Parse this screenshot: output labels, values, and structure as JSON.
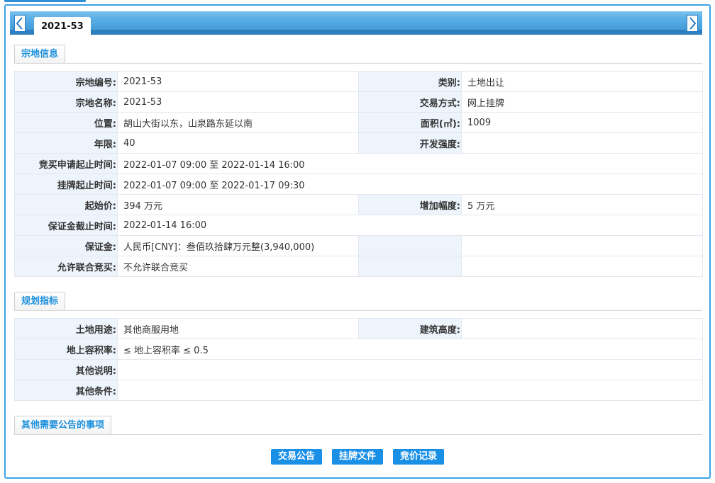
{
  "tab": {
    "label": "2021-53"
  },
  "sections": {
    "basic": "宗地信息",
    "planning": "规划指标",
    "other": "其他需要公告的事项"
  },
  "basic_rows": [
    {
      "k1": "宗地编号:",
      "v1": "2021-53",
      "k2": "类别:",
      "v2": "土地出让"
    },
    {
      "k1": "宗地名称:",
      "v1": "2021-53",
      "k2": "交易方式:",
      "v2": "网上挂牌"
    },
    {
      "k1": "位置:",
      "v1": "胡山大街以东，山泉路东延以南",
      "k2": "面积(㎡):",
      "v2": "1009"
    },
    {
      "k1": "年限:",
      "v1": "40",
      "k2": "开发强度:",
      "v2": ""
    },
    {
      "k1": "竞买申请起止时间:",
      "v1": "2022-01-07 09:00 至 2022-01-14 16:00"
    },
    {
      "k1": "挂牌起止时间:",
      "v1": "2022-01-07 09:00 至 2022-01-17 09:30"
    },
    {
      "k1": "起始价:",
      "v1": "394 万元",
      "k2": "增加幅度:",
      "v2": "5 万元"
    },
    {
      "k1": "保证金截止时间:",
      "v1": "2022-01-14 16:00"
    },
    {
      "k1": "保证金:",
      "v1": "人民币[CNY]：叁佰玖拾肆万元整(3,940,000)",
      "k2": "",
      "v2": ""
    },
    {
      "k1": "允许联合竞买:",
      "v1": "不允许联合竞买",
      "k2": "",
      "v2": ""
    }
  ],
  "planning_rows": [
    {
      "k1": "土地用途:",
      "v1": "其他商服用地",
      "k2": "建筑高度:",
      "v2": ""
    },
    {
      "k1": "地上容积率:",
      "v1": "≤ 地上容积率 ≤ 0.5"
    },
    {
      "k1": "其他说明:",
      "v1": ""
    },
    {
      "k1": "其他条件:",
      "v1": ""
    }
  ],
  "buttons": {
    "notice": "交易公告",
    "files": "挂牌文件",
    "bids": "竞价记录"
  },
  "icons": {
    "prev": "chevron-left-icon",
    "next": "chevron-right-icon"
  },
  "colors": {
    "accent": "#1a8fe6",
    "tabbar": "#5aafe6",
    "label_bg": "#eef4fc"
  }
}
